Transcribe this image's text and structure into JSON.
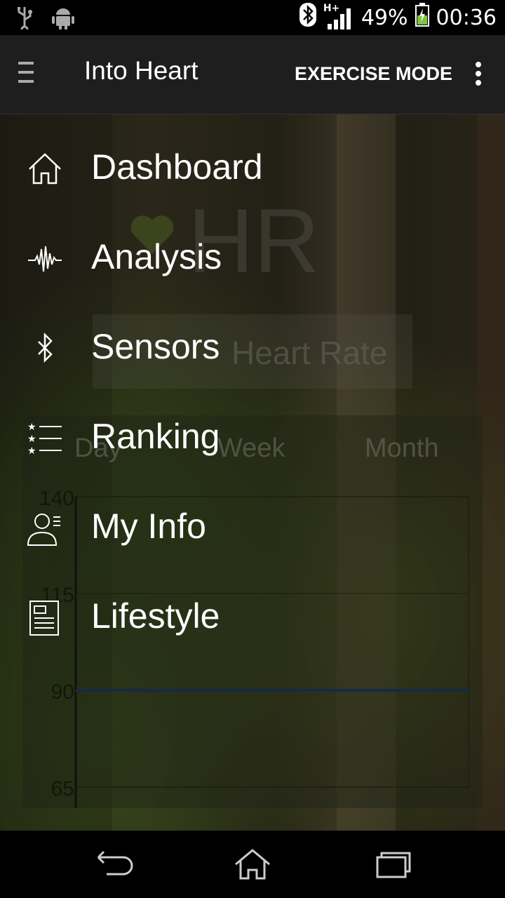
{
  "status_bar": {
    "network": "H+",
    "battery_percent": "49%",
    "time": "00:36",
    "icons": [
      "usb-icon",
      "android-debug-icon",
      "bluetooth-icon",
      "signal-icon",
      "battery-charging-icon"
    ]
  },
  "app_bar": {
    "title": "Into Heart",
    "action": "EXERCISE MODE"
  },
  "background_screen": {
    "hr_label": "HR",
    "rate_label": "Heart Rate",
    "range_tabs": [
      "Day",
      "Week",
      "Month"
    ],
    "y_ticks": [
      "140",
      "115",
      "90",
      "65"
    ]
  },
  "chart_data": {
    "type": "line",
    "y_ticks": [
      140,
      115,
      90,
      65
    ],
    "ylim": [
      65,
      140
    ],
    "series": [
      {
        "values": [
          90,
          90
        ]
      }
    ],
    "grid": true
  },
  "drawer": {
    "items": [
      {
        "label": "Dashboard",
        "icon": "home-icon"
      },
      {
        "label": "Analysis",
        "icon": "waveform-icon"
      },
      {
        "label": "Sensors",
        "icon": "bluetooth-icon"
      },
      {
        "label": "Ranking",
        "icon": "ranked-list-icon"
      },
      {
        "label": "My Info",
        "icon": "profile-icon"
      },
      {
        "label": "Lifestyle",
        "icon": "document-icon"
      }
    ]
  },
  "nav_bar": {
    "buttons": [
      "back-icon",
      "home-icon",
      "recents-icon"
    ]
  }
}
